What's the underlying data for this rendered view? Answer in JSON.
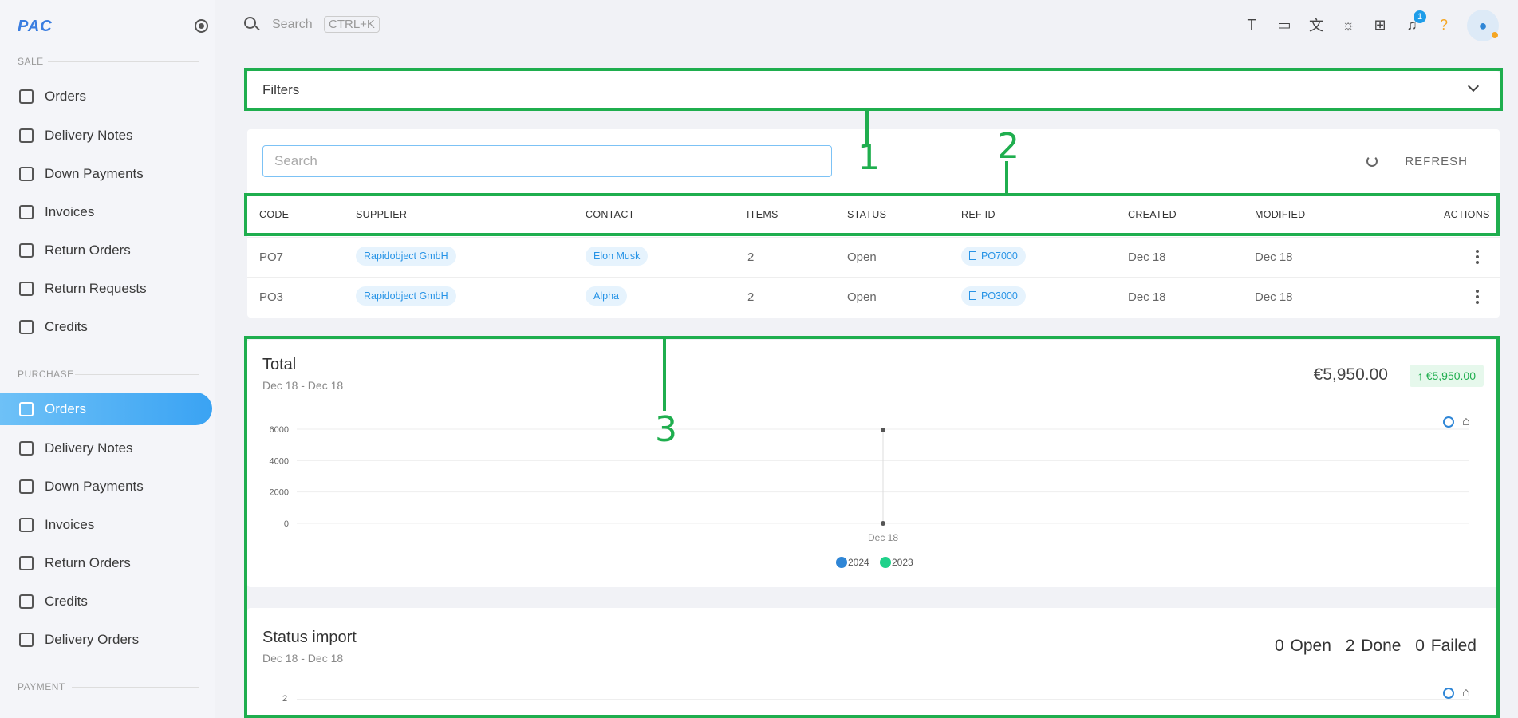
{
  "brand": {
    "logo": "PAC"
  },
  "sidebar": {
    "sections": [
      {
        "title": "SALE",
        "items": [
          "Orders",
          "Delivery Notes",
          "Down Payments",
          "Invoices",
          "Return Orders",
          "Return Requests",
          "Credits"
        ]
      },
      {
        "title": "PURCHASE",
        "items": [
          "Orders",
          "Delivery Notes",
          "Down Payments",
          "Invoices",
          "Return Orders",
          "Credits",
          "Delivery Orders"
        ]
      },
      {
        "title": "PAYMENT",
        "items": []
      }
    ],
    "active": "PURCHASE.Orders"
  },
  "topbar": {
    "search_placeholder": "Search",
    "shortcut": "CTRL+K",
    "notification_count": "1",
    "icons": [
      "text-height-icon",
      "fullscreen-icon",
      "translate-icon",
      "brightness-icon",
      "sitemap-icon",
      "bell-icon",
      "help-icon",
      "user-icon"
    ]
  },
  "filters": {
    "label": "Filters"
  },
  "list": {
    "search_placeholder": "Search",
    "refresh_label": "REFRESH",
    "columns": [
      "CODE",
      "SUPPLIER",
      "CONTACT",
      "ITEMS",
      "STATUS",
      "REF ID",
      "CREATED",
      "MODIFIED",
      "ACTIONS"
    ],
    "rows": [
      {
        "code": "PO7",
        "supplier": "Rapidobject GmbH",
        "contact": "Elon Musk",
        "items": "2",
        "status": "Open",
        "ref_id": "PO7000",
        "created": "Dec 18",
        "modified": "Dec 18"
      },
      {
        "code": "PO3",
        "supplier": "Rapidobject GmbH",
        "contact": "Alpha",
        "items": "2",
        "status": "Open",
        "ref_id": "PO3000",
        "created": "Dec 18",
        "modified": "Dec 18"
      }
    ]
  },
  "total": {
    "title": "Total",
    "range": "Dec 18 - Dec 18",
    "amount": "€5,950.00",
    "delta": "€5,950.00"
  },
  "chart_data": {
    "type": "line",
    "x": [
      "Dec 18"
    ],
    "yticks": [
      "6000",
      "4000",
      "2000",
      "0"
    ],
    "ylim": [
      0,
      6000
    ],
    "series": [
      {
        "name": "2024",
        "values": [
          5950
        ],
        "color": "#2f86d6"
      },
      {
        "name": "2023",
        "values": [
          0
        ],
        "color": "#1fd18a"
      }
    ],
    "legend": "bottom-center"
  },
  "status_import": {
    "title": "Status import",
    "range": "Dec 18 - Dec 18",
    "open": "0 Open",
    "done": "2 Done",
    "failed": "0 Failed",
    "ytick": "2"
  },
  "annotations": {
    "one": "1",
    "two": "2",
    "three": "3"
  },
  "colors": {
    "accent": "#3aa3f3",
    "annotation": "#1fae4e"
  }
}
